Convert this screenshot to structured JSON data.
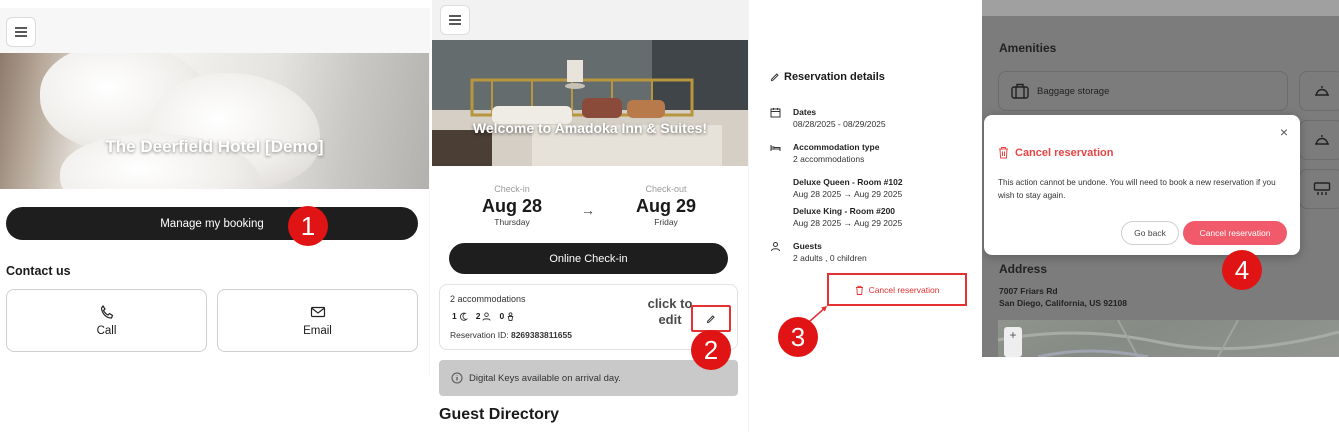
{
  "panel1": {
    "hotel_title": "The Deerfield Hotel [Demo]",
    "manage_button": "Manage my booking",
    "contact_heading": "Contact us",
    "call_label": "Call",
    "email_label": "Email",
    "callout": "1"
  },
  "panel2": {
    "hero_title": "Welcome to Amadoka Inn & Suites!",
    "checkin_label": "Check-in",
    "checkin_date": "Aug 28",
    "checkin_day": "Thursday",
    "checkout_label": "Check-out",
    "checkout_date": "Aug 29",
    "checkout_day": "Friday",
    "arrow": "→",
    "online_checkin_button": "Online Check-in",
    "accommodations": "2 accommodations",
    "counts": {
      "nights": "1",
      "adults": "2",
      "children": "0"
    },
    "reservation_id_label": "Reservation ID:",
    "reservation_id": "8269383811655",
    "click_note_line1": "click to",
    "click_note_line2": "edit",
    "digital_keys": "Digital Keys available on arrival day.",
    "guest_directory": "Guest Directory",
    "callout": "2"
  },
  "panel3": {
    "title": "Reservation details",
    "dates_heading": "Dates",
    "dates_value": "08/28/2025 - 08/29/2025",
    "accommodation_heading": "Accommodation type",
    "accommodation_value": "2 accommodations",
    "rooms": [
      {
        "name": "Deluxe Queen - Room #102",
        "from": "Aug 28 2025",
        "to": "Aug 29 2025"
      },
      {
        "name": "Deluxe King - Room #200",
        "from": "Aug 28 2025",
        "to": "Aug 29 2025"
      }
    ],
    "arrow": "→",
    "guests_heading": "Guests",
    "guests_value": "2 adults , 0 children",
    "cancel_link": "Cancel reservation",
    "callout": "3"
  },
  "panel4": {
    "amenities_heading": "Amenities",
    "amenity_1": "Baggage storage",
    "address_heading": "Address",
    "address_line1": "7007 Friars Rd",
    "address_line2": "San Diego, California, US 92108",
    "modal": {
      "close": "×",
      "title": "Cancel reservation",
      "body": "This action cannot be undone. You will need to book a new reservation if you wish to stay again.",
      "go_back": "Go back",
      "confirm": "Cancel reservation"
    },
    "zoom_in": "+",
    "callout": "4"
  },
  "colors": {
    "accent_red": "#e01414",
    "cancel_red": "#e84545",
    "dark_button": "#1e1e1e",
    "confirm_pink": "#f05a6a"
  }
}
